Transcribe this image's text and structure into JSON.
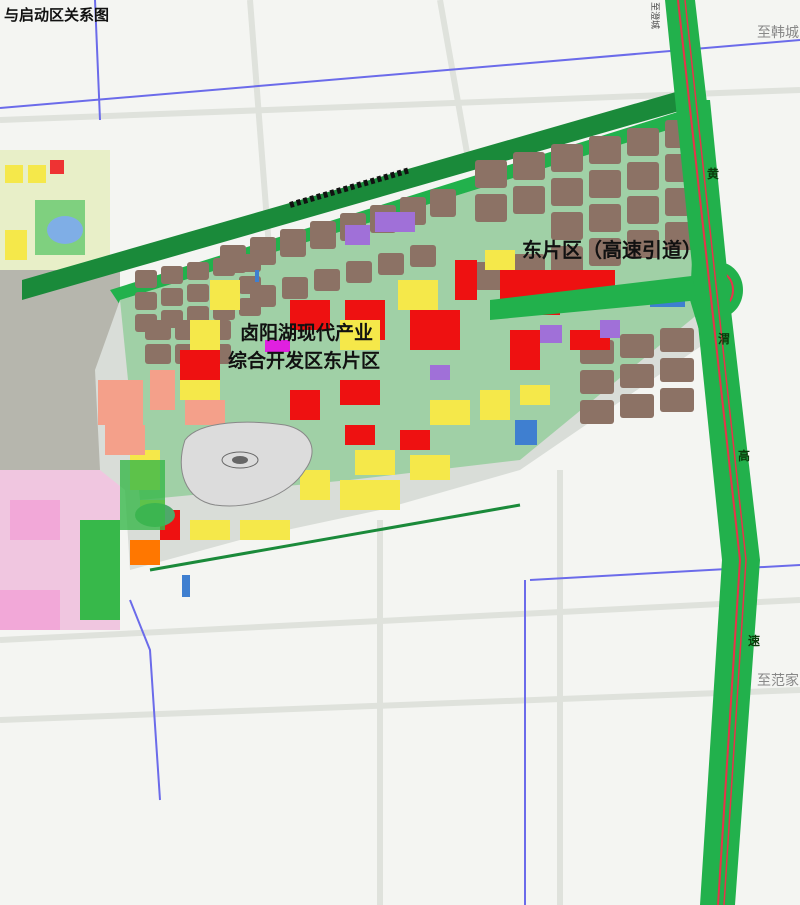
{
  "title": "与启动区关系图",
  "labels": {
    "east_zone": "东片区（高速引道）",
    "central_zone_line1": "卤阳湖现代产业",
    "central_zone_line2": "综合开发区东片区",
    "dest_top": "至韩城",
    "dest_right": "至范家",
    "highway_chars": [
      "黄",
      "渭",
      "高",
      "速"
    ],
    "road_small_top": "至澄城"
  },
  "colors": {
    "background": "#f4f5f2",
    "road_gray": "#d9ddd8",
    "residential_brown": "#8c7265",
    "commercial_red": "#ee1111",
    "yellow_land": "#f5e84a",
    "green_space": "#37b84a",
    "dark_green_belt": "#1a8a3a",
    "highway_green": "#22b14c",
    "highway_red": "#e8334a",
    "purple_public": "#a070d8",
    "pink_salmon": "#f4a08a",
    "blue_water": "#3f7fd0",
    "boundary_blue": "#6060e0"
  }
}
